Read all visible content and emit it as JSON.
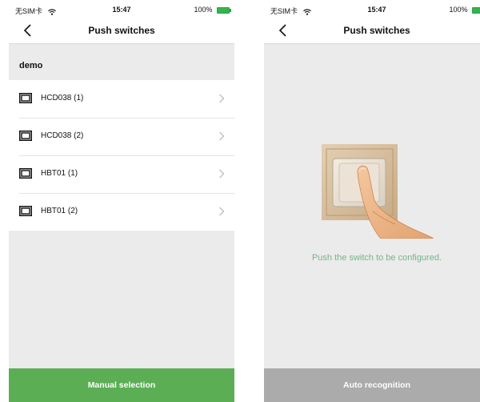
{
  "statusbar": {
    "carrier": "无SIM卡",
    "time": "15:47",
    "battery": "100%"
  },
  "left": {
    "title": "Push switches",
    "section": "demo",
    "items": [
      {
        "label": "HCD038 (1)"
      },
      {
        "label": "HCD038 (2)"
      },
      {
        "label": "HBT01 (1)"
      },
      {
        "label": "HBT01 (2)"
      }
    ],
    "button_label": "Manual selection"
  },
  "right": {
    "title": "Push switches",
    "instruction": "Push the switch to be configured.",
    "button_label": "Auto recognition"
  },
  "colors": {
    "green": "#5cae55",
    "grey_button": "#ababab",
    "instruction": "#76b58a",
    "background": "#ebebeb"
  }
}
